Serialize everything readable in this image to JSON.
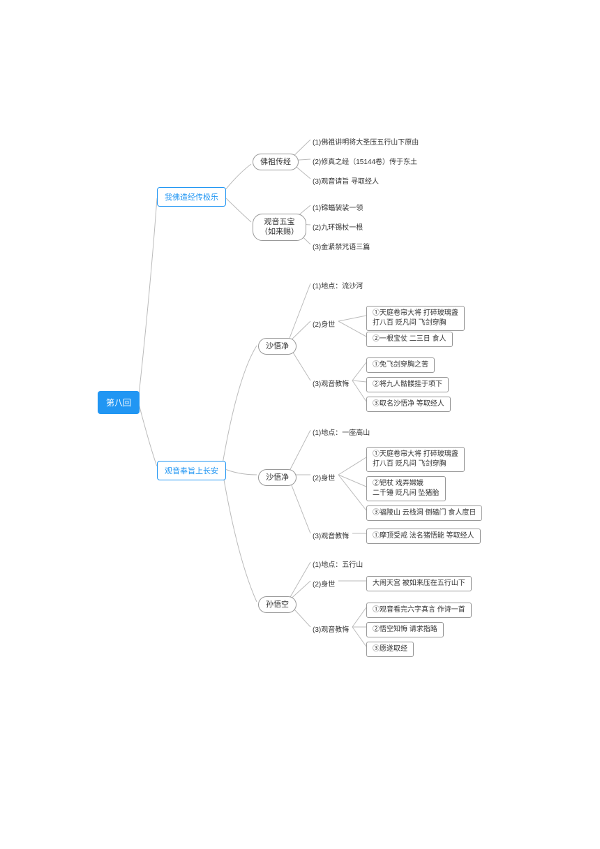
{
  "root": "第八回",
  "branch1": {
    "title": "我佛造经传极乐",
    "n1": {
      "label": "佛祖传经",
      "items": [
        "(1)佛祖讲明将大圣压五行山下原由",
        "(2)修真之经（15144卷）传于东土",
        "(3)观音请旨 寻取经人"
      ]
    },
    "n2": {
      "label": "观音五宝\n（如来赐）",
      "items": [
        "(1)锦蝠袈裟一领",
        "(2)九环锡杖一根",
        "(3)金紧禁咒语三篇"
      ]
    }
  },
  "branch2": {
    "title": "观音奉旨上长安",
    "c1": {
      "name": "沙悟净",
      "loc": "(1)地点：流沙河",
      "bg_label": "(2)身世",
      "bg_items": [
        "①天庭卷帘大将 打碎玻璃盏\n打八百 贬凡间 飞剑穿胸",
        "②一根宝仗 二三日 食人"
      ],
      "gy_label": "(3)观音教悔",
      "gy_items": [
        "①免飞剑穿胸之苦",
        "②将九人骷髅挂于项下",
        "③取名沙悟净 等取经人"
      ]
    },
    "c2": {
      "name": "沙悟净",
      "loc": "(1)地点：一座高山",
      "bg_label": "(2)身世",
      "bg_items": [
        "①天庭卷帘大将 打碎玻璃盏\n打八百 贬凡间 飞剑穿胸",
        "②钯杖 戏弄嫦娥\n二千锤 贬凡间 坠猪胎",
        "③福陵山 云栈洞 倒磕门 食人度日"
      ],
      "gy_label": "(3)观音教悔",
      "gy_items": [
        "①摩顶受戒 法名猪悟能 等取经人"
      ]
    },
    "c3": {
      "name": "孙悟空",
      "loc": "(1)地点：五行山",
      "bg_label": "(2)身世",
      "bg_items": [
        "大闹天宫 被如来压在五行山下"
      ],
      "gy_label": "(3)观音教悔",
      "gy_items": [
        "①观音看完六字真言 作诗一首",
        "②悟空知悔 请求指路",
        "③愿遂取经"
      ]
    }
  }
}
